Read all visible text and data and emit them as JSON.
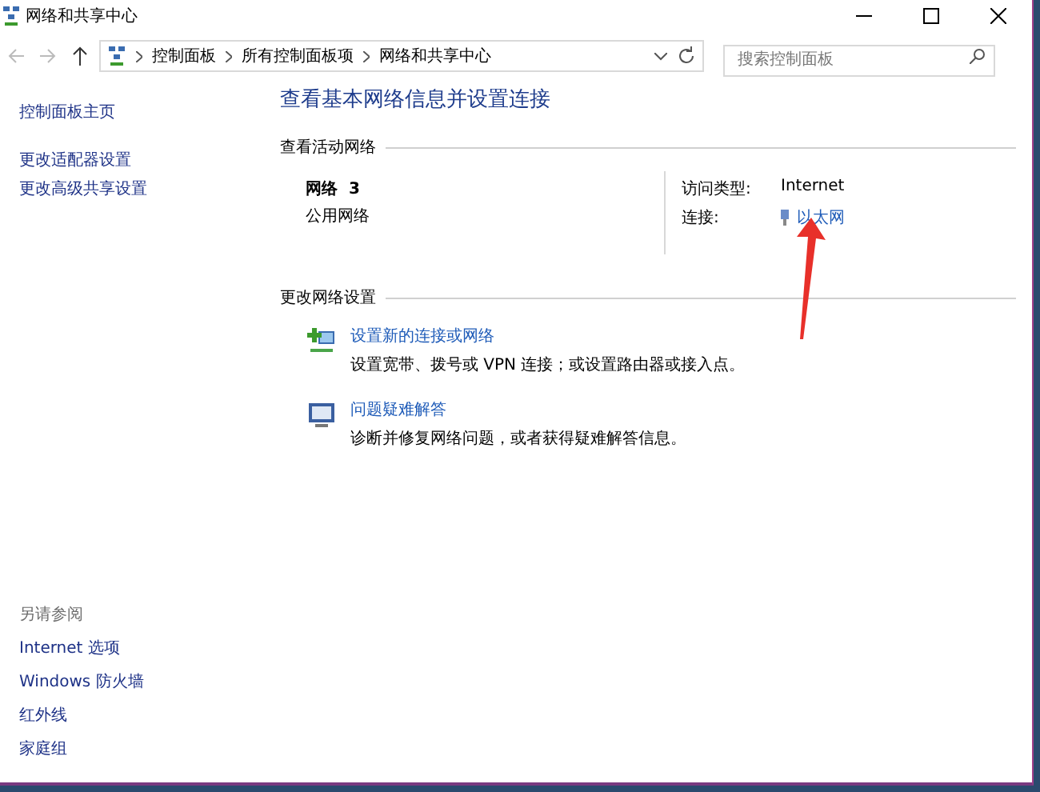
{
  "window": {
    "title": "网络和共享中心"
  },
  "address_bar": {
    "path": [
      "控制面板",
      "所有控制面板项",
      "网络和共享中心"
    ]
  },
  "search": {
    "placeholder": "搜索控制面板"
  },
  "sidebar": {
    "items": [
      "控制面板主页",
      "更改适配器设置",
      "更改高级共享设置"
    ],
    "see_also_title": "另请参阅",
    "see_also": [
      "Internet 选项",
      "Windows 防火墙",
      "红外线",
      "家庭组"
    ]
  },
  "main": {
    "heading": "查看基本网络信息并设置连接",
    "active_section": "查看活动网络",
    "network": {
      "name": "网络  3",
      "type": "公用网络",
      "access_label": "访问类型:",
      "access_value": "Internet",
      "connection_label": "连接:",
      "connection_value": "以太网"
    },
    "change_section": "更改网络设置",
    "tasks": [
      {
        "kind": "new-connection",
        "title": "设置新的连接或网络",
        "description": "设置宽带、拨号或 VPN 连接；或设置路由器或接入点。"
      },
      {
        "kind": "troubleshoot",
        "title": "问题疑难解答",
        "description": "诊断并修复网络问题，或者获得疑难解答信息。"
      }
    ]
  }
}
